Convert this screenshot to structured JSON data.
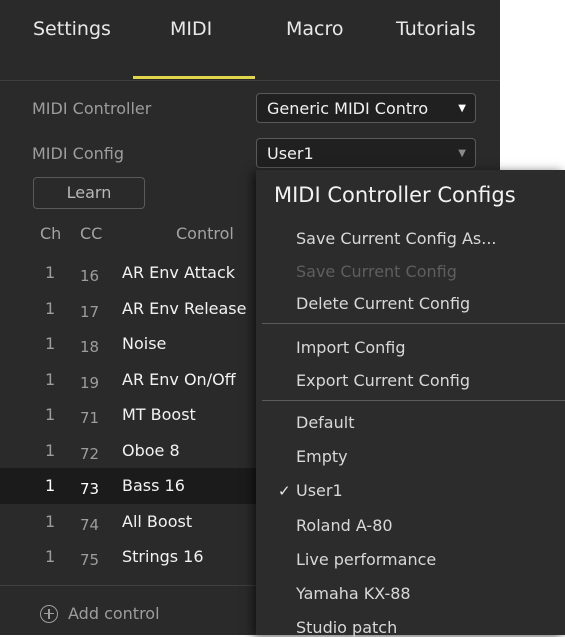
{
  "tabs": [
    {
      "label": "Settings"
    },
    {
      "label": "MIDI"
    },
    {
      "label": "Macro"
    },
    {
      "label": "Tutorials"
    }
  ],
  "midi_controller": {
    "label": "MIDI Controller",
    "value": "Generic MIDI Contro"
  },
  "midi_config": {
    "label": "MIDI Config",
    "value": "User1"
  },
  "learn_label": "Learn",
  "table_headers": {
    "ch": "Ch",
    "cc": "CC",
    "control": "Control"
  },
  "rows": [
    {
      "ch": "1",
      "cc": "16",
      "name": "AR Env Attack"
    },
    {
      "ch": "1",
      "cc": "17",
      "name": "AR Env Release"
    },
    {
      "ch": "1",
      "cc": "18",
      "name": "Noise"
    },
    {
      "ch": "1",
      "cc": "19",
      "name": "AR Env On/Off"
    },
    {
      "ch": "1",
      "cc": "71",
      "name": "MT Boost"
    },
    {
      "ch": "1",
      "cc": "72",
      "name": "Oboe 8"
    },
    {
      "ch": "1",
      "cc": "73",
      "name": "Bass 16",
      "selected": true
    },
    {
      "ch": "1",
      "cc": "74",
      "name": "All Boost"
    },
    {
      "ch": "1",
      "cc": "75",
      "name": "Strings 16"
    }
  ],
  "add_control_label": "Add control",
  "menu": {
    "title": "MIDI Controller Configs",
    "actions": [
      {
        "label": "Save Current Config As...",
        "enabled": true
      },
      {
        "label": "Save Current Config",
        "enabled": false
      },
      {
        "label": "Delete Current Config",
        "enabled": true
      }
    ],
    "io": [
      {
        "label": "Import Config"
      },
      {
        "label": "Export Current Config"
      }
    ],
    "configs": [
      {
        "label": "Default",
        "checked": false
      },
      {
        "label": "Empty",
        "checked": false
      },
      {
        "label": "User1",
        "checked": true
      },
      {
        "label": "Roland A-80",
        "checked": false
      },
      {
        "label": "Live performance",
        "checked": false
      },
      {
        "label": "Yamaha KX-88",
        "checked": false
      },
      {
        "label": "Studio patch",
        "checked": false
      }
    ],
    "check_glyph": "✓"
  },
  "colors": {
    "panel_bg": "#2a2a2a",
    "accent_underline": "#e1d64a",
    "menu_bg": "#2c2c2c",
    "text_primary": "#f2f2f2",
    "text_secondary": "#9d9d9d",
    "text_disabled": "#5e5e5e"
  }
}
